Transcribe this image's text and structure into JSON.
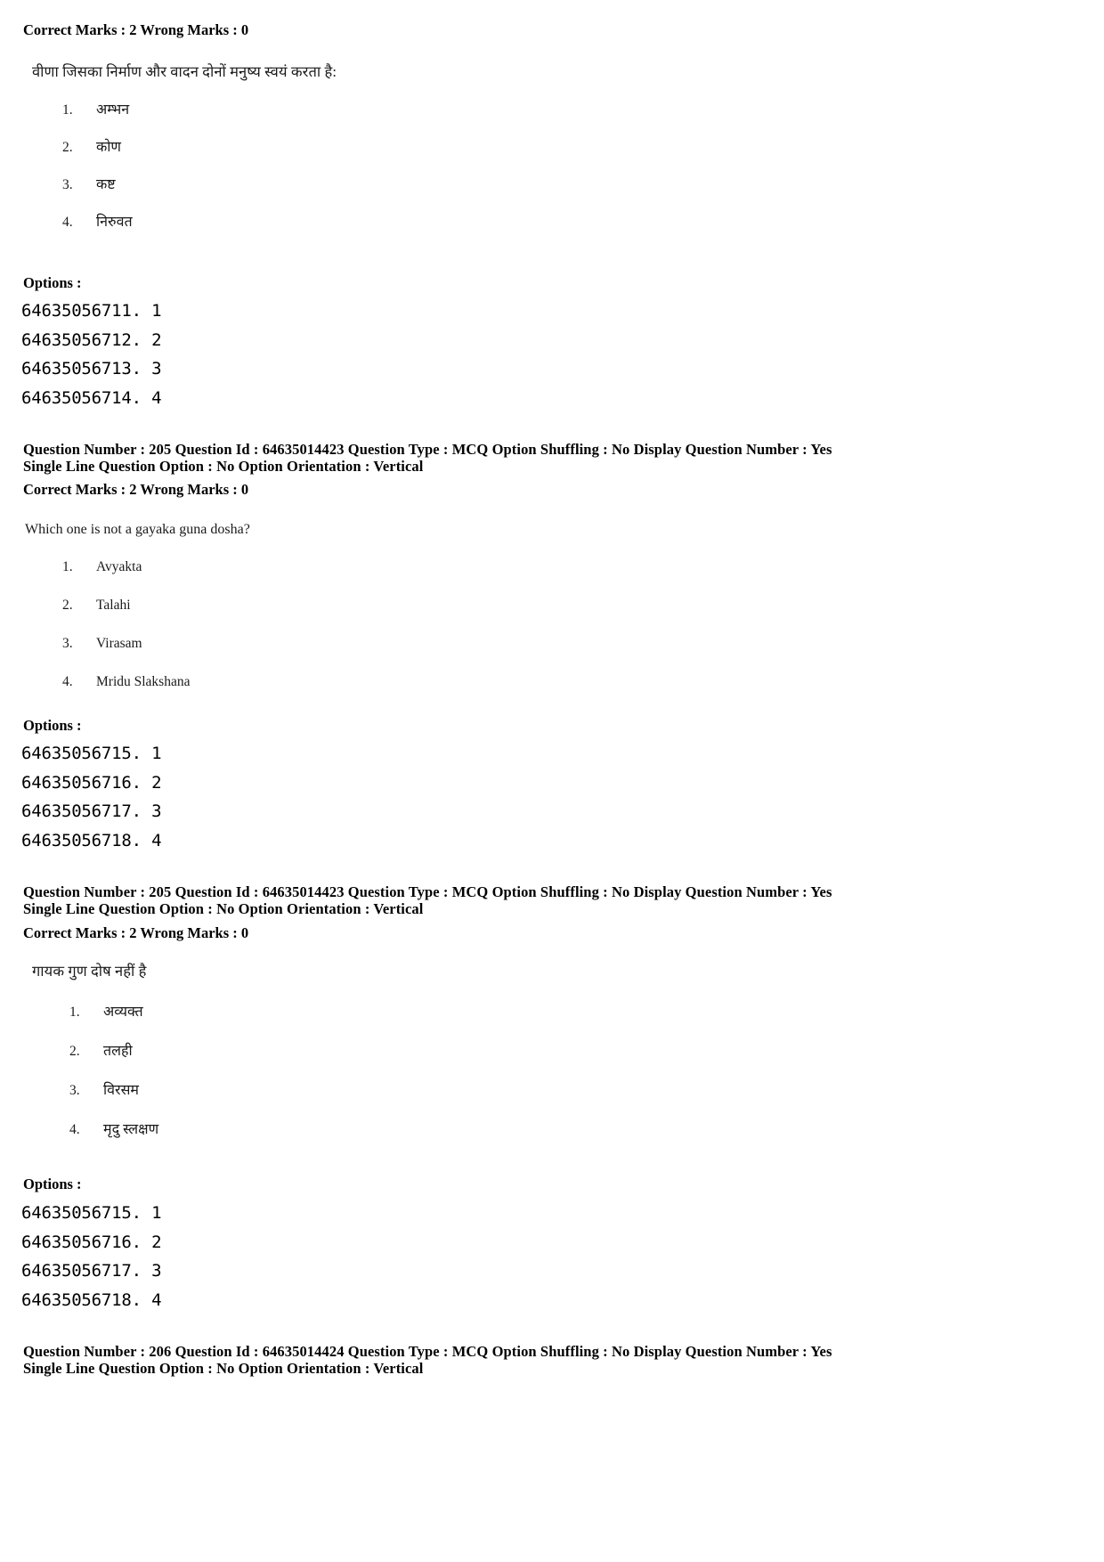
{
  "document": {
    "type": "exam-answer-key-pdf",
    "page_background": "#ffffff",
    "text_color": "#000000"
  },
  "blocks": [
    {
      "id": "block-1-marks",
      "marks_line": "Correct Marks : 2  Wrong Marks : 0"
    }
  ],
  "question_1": {
    "marks_line": "Correct Marks : 2  Wrong Marks : 0",
    "stem": "वीणा जिसका निर्माण और वादन दोनों मनुष्य स्वयं करता  है:",
    "choices": [
      {
        "num": "1.",
        "text": "अम्भन"
      },
      {
        "num": "2.",
        "text": "कोण"
      },
      {
        "num": "3.",
        "text": "कष्ट"
      },
      {
        "num": "4.",
        "text": "निरुवत"
      }
    ],
    "options_label": "Options :",
    "option_ids": [
      "64635056711. 1",
      "64635056712. 2",
      "64635056713. 3",
      "64635056714. 4"
    ]
  },
  "question_2": {
    "meta_line_1": "Question Number : 205  Question Id : 64635014423  Question Type : MCQ  Option Shuffling : No  Display Question Number : Yes",
    "meta_line_2": "Single Line Question Option : No  Option Orientation : Vertical",
    "marks_line": "Correct Marks : 2  Wrong Marks : 0",
    "stem": "Which one is not a gayaka guna dosha?",
    "choices": [
      {
        "num": "1.",
        "text": "Avyakta"
      },
      {
        "num": "2.",
        "text": "Talahi"
      },
      {
        "num": "3.",
        "text": "Virasam"
      },
      {
        "num": "4.",
        "text": "Mridu Slakshana"
      }
    ],
    "options_label": "Options :",
    "option_ids": [
      "64635056715. 1",
      "64635056716. 2",
      "64635056717. 3",
      "64635056718. 4"
    ]
  },
  "question_3": {
    "meta_line_1": "Question Number : 205  Question Id : 64635014423  Question Type : MCQ  Option Shuffling : No  Display Question Number : Yes",
    "meta_line_2": "Single Line Question Option : No  Option Orientation : Vertical",
    "marks_line": "Correct Marks : 2  Wrong Marks : 0",
    "stem": "गायक गुण दोष नहीं है",
    "choices": [
      {
        "num": "1.",
        "text": "अव्यक्त"
      },
      {
        "num": "2.",
        "text": "तलही"
      },
      {
        "num": "3.",
        "text": "विरसम"
      },
      {
        "num": "4.",
        "text": "मृदु स्लक्षण"
      }
    ],
    "options_label": "Options :",
    "option_ids": [
      "64635056715. 1",
      "64635056716. 2",
      "64635056717. 3",
      "64635056718. 4"
    ]
  },
  "question_4": {
    "meta_line_1": "Question Number : 206  Question Id : 64635014424  Question Type : MCQ  Option Shuffling : No  Display Question Number : Yes",
    "meta_line_2": "Single Line Question Option : No  Option Orientation : Vertical"
  }
}
